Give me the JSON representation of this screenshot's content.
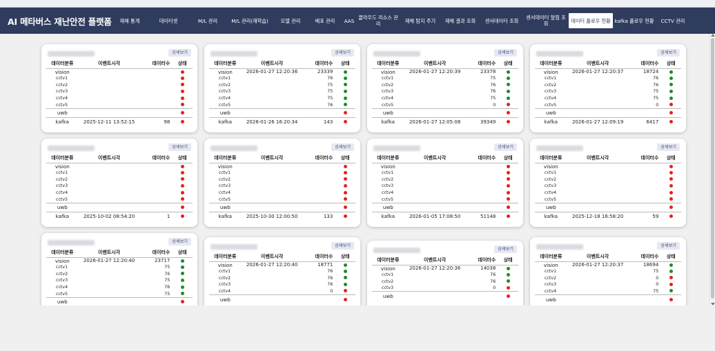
{
  "app": {
    "title": "AI 메타버스 재난안전 플랫폼",
    "menu": [
      {
        "label": "재해 통계",
        "w": 0
      },
      {
        "label": "데이터셋"
      },
      {
        "label": "M/L 관리"
      },
      {
        "label": "M/L 관리(재학습)"
      },
      {
        "label": "모델 관리"
      },
      {
        "label": "배포 관리"
      },
      {
        "label": "AAS"
      },
      {
        "label": "클라우드 리소스 관리"
      },
      {
        "label": "재해 탐지 주기"
      },
      {
        "label": "재해 결과 조회"
      },
      {
        "label": "센서데이터 조회"
      },
      {
        "label": "센서데이터 알림 조회"
      },
      {
        "label": "데이터 플로우 현황",
        "active": true
      },
      {
        "label": "kafka 플로우 현황"
      },
      {
        "label": "CCTV 관리"
      }
    ]
  },
  "labels": {
    "detail": "상세보기",
    "col_category": "데이터분류",
    "col_event_time": "이벤트시각",
    "col_count": "데이터수",
    "col_status": "상태"
  },
  "status_colors": {
    "red": "#e2231a",
    "green": "#1e8a2e"
  },
  "cards": [
    {
      "rows": [
        {
          "name": "vision",
          "time": "",
          "count": "",
          "status": "red"
        },
        {
          "name": "cctv1",
          "sub": true,
          "time": "",
          "count": "",
          "status": "red"
        },
        {
          "name": "cctv2",
          "sub": true,
          "time": "",
          "count": "",
          "status": "red"
        },
        {
          "name": "cctv3",
          "sub": true,
          "time": "",
          "count": "",
          "status": "red"
        },
        {
          "name": "cctv4",
          "sub": true,
          "time": "",
          "count": "",
          "status": "red"
        },
        {
          "name": "cctv5",
          "sub": true,
          "time": "",
          "count": "",
          "status": "red"
        },
        {
          "name": "uwb",
          "time": "",
          "count": "",
          "status": "red",
          "sep": true
        },
        {
          "name": "kafka",
          "time": "2025-12-11 13:52:15",
          "count": "98",
          "status": "red",
          "sep": true
        }
      ]
    },
    {
      "rows": [
        {
          "name": "vision",
          "time": "2026-01-27 12:20:36",
          "count": "23339",
          "status": "green"
        },
        {
          "name": "cctv1",
          "sub": true,
          "time": "",
          "count": "76",
          "status": "green"
        },
        {
          "name": "cctv2",
          "sub": true,
          "time": "",
          "count": "75",
          "status": "green"
        },
        {
          "name": "cctv3",
          "sub": true,
          "time": "",
          "count": "75",
          "status": "green"
        },
        {
          "name": "cctv4",
          "sub": true,
          "time": "",
          "count": "75",
          "status": "green"
        },
        {
          "name": "cctv5",
          "sub": true,
          "time": "",
          "count": "76",
          "status": "green"
        },
        {
          "name": "uwb",
          "time": "",
          "count": "",
          "status": "red",
          "sep": true
        },
        {
          "name": "kafka",
          "time": "2026-01-26 16:20:34",
          "count": "143",
          "status": "red",
          "sep": true
        }
      ]
    },
    {
      "rows": [
        {
          "name": "vision",
          "time": "2026-01-27 12:20:39",
          "count": "23378",
          "status": "green"
        },
        {
          "name": "cctv1",
          "sub": true,
          "time": "",
          "count": "75",
          "status": "green"
        },
        {
          "name": "cctv2",
          "sub": true,
          "time": "",
          "count": "76",
          "status": "green"
        },
        {
          "name": "cctv3",
          "sub": true,
          "time": "",
          "count": "76",
          "status": "green"
        },
        {
          "name": "cctv4",
          "sub": true,
          "time": "",
          "count": "75",
          "status": "green"
        },
        {
          "name": "cctv5",
          "sub": true,
          "time": "",
          "count": "0",
          "status": "red"
        },
        {
          "name": "uwb",
          "time": "",
          "count": "",
          "status": "red",
          "sep": true
        },
        {
          "name": "kafka",
          "time": "2026-01-27 12:05:08",
          "count": "39349",
          "status": "red",
          "sep": true
        }
      ]
    },
    {
      "rows": [
        {
          "name": "vision",
          "time": "2026-01-27 12:20:37",
          "count": "18724",
          "status": "green"
        },
        {
          "name": "cctv1",
          "sub": true,
          "time": "",
          "count": "76",
          "status": "green"
        },
        {
          "name": "cctv2",
          "sub": true,
          "time": "",
          "count": "76",
          "status": "green"
        },
        {
          "name": "cctv3",
          "sub": true,
          "time": "",
          "count": "75",
          "status": "green"
        },
        {
          "name": "cctv4",
          "sub": true,
          "time": "",
          "count": "75",
          "status": "green"
        },
        {
          "name": "cctv5",
          "sub": true,
          "time": "",
          "count": "0",
          "status": "red"
        },
        {
          "name": "uwb",
          "time": "",
          "count": "",
          "status": "red",
          "sep": true
        },
        {
          "name": "kafka",
          "time": "2026-01-27 12:09:19",
          "count": "6417",
          "status": "red",
          "sep": true
        }
      ]
    },
    {
      "rows": [
        {
          "name": "vision",
          "time": "",
          "count": "",
          "status": "red"
        },
        {
          "name": "cctv1",
          "sub": true,
          "time": "",
          "count": "",
          "status": "red"
        },
        {
          "name": "cctv2",
          "sub": true,
          "time": "",
          "count": "",
          "status": "red"
        },
        {
          "name": "cctv3",
          "sub": true,
          "time": "",
          "count": "",
          "status": "red"
        },
        {
          "name": "cctv4",
          "sub": true,
          "time": "",
          "count": "",
          "status": "red"
        },
        {
          "name": "cctv5",
          "sub": true,
          "time": "",
          "count": "",
          "status": "red"
        },
        {
          "name": "uwb",
          "time": "",
          "count": "",
          "status": "red",
          "sep": true
        },
        {
          "name": "kafka",
          "time": "2025-10-02 08:54:20",
          "count": "1",
          "status": "red",
          "sep": true
        }
      ]
    },
    {
      "rows": [
        {
          "name": "vision",
          "time": "",
          "count": "",
          "status": "red"
        },
        {
          "name": "cctv1",
          "sub": true,
          "time": "",
          "count": "",
          "status": "red"
        },
        {
          "name": "cctv2",
          "sub": true,
          "time": "",
          "count": "",
          "status": "red"
        },
        {
          "name": "cctv3",
          "sub": true,
          "time": "",
          "count": "",
          "status": "red"
        },
        {
          "name": "cctv4",
          "sub": true,
          "time": "",
          "count": "",
          "status": "red"
        },
        {
          "name": "cctv5",
          "sub": true,
          "time": "",
          "count": "",
          "status": "red"
        },
        {
          "name": "uwb",
          "time": "",
          "count": "",
          "status": "red",
          "sep": true
        },
        {
          "name": "kafka",
          "time": "2025-10-30 12:00:50",
          "count": "133",
          "status": "red",
          "sep": true
        }
      ]
    },
    {
      "rows": [
        {
          "name": "vision",
          "time": "",
          "count": "",
          "status": "red"
        },
        {
          "name": "cctv1",
          "sub": true,
          "time": "",
          "count": "",
          "status": "red"
        },
        {
          "name": "cctv2",
          "sub": true,
          "time": "",
          "count": "",
          "status": "red"
        },
        {
          "name": "cctv3",
          "sub": true,
          "time": "",
          "count": "",
          "status": "red"
        },
        {
          "name": "cctv4",
          "sub": true,
          "time": "",
          "count": "",
          "status": "red"
        },
        {
          "name": "cctv5",
          "sub": true,
          "time": "",
          "count": "",
          "status": "red"
        },
        {
          "name": "uwb",
          "time": "",
          "count": "",
          "status": "red",
          "sep": true
        },
        {
          "name": "kafka",
          "time": "2026-01-05 17:08:50",
          "count": "51148",
          "status": "red",
          "sep": true
        }
      ]
    },
    {
      "rows": [
        {
          "name": "vision",
          "time": "",
          "count": "",
          "status": "red"
        },
        {
          "name": "cctv1",
          "sub": true,
          "time": "",
          "count": "",
          "status": "red"
        },
        {
          "name": "cctv2",
          "sub": true,
          "time": "",
          "count": "",
          "status": "red"
        },
        {
          "name": "cctv3",
          "sub": true,
          "time": "",
          "count": "",
          "status": "red"
        },
        {
          "name": "cctv4",
          "sub": true,
          "time": "",
          "count": "",
          "status": "red"
        },
        {
          "name": "cctv5",
          "sub": true,
          "time": "",
          "count": "",
          "status": "red"
        },
        {
          "name": "uwb",
          "time": "",
          "count": "",
          "status": "red",
          "sep": true
        },
        {
          "name": "kafka",
          "time": "2025-12-18 16:58:20",
          "count": "59",
          "status": "red",
          "sep": true
        }
      ]
    },
    {
      "rows": [
        {
          "name": "vision",
          "time": "2026-01-27 12:20:40",
          "count": "23717",
          "status": "green"
        },
        {
          "name": "cctv1",
          "sub": true,
          "time": "",
          "count": "75",
          "status": "green"
        },
        {
          "name": "cctv2",
          "sub": true,
          "time": "",
          "count": "76",
          "status": "green"
        },
        {
          "name": "cctv3",
          "sub": true,
          "time": "",
          "count": "75",
          "status": "green"
        },
        {
          "name": "cctv4",
          "sub": true,
          "time": "",
          "count": "76",
          "status": "green"
        },
        {
          "name": "cctv5",
          "sub": true,
          "time": "",
          "count": "75",
          "status": "green"
        },
        {
          "name": "uwb",
          "time": "",
          "count": "",
          "status": "red",
          "sep": true
        }
      ]
    },
    {
      "rows": [
        {
          "name": "vision",
          "time": "2026-01-27 12:20:40",
          "count": "18771",
          "status": "green"
        },
        {
          "name": "cctv1",
          "sub": true,
          "time": "",
          "count": "76",
          "status": "green"
        },
        {
          "name": "cctv2",
          "sub": true,
          "time": "",
          "count": "76",
          "status": "green"
        },
        {
          "name": "cctv3",
          "sub": true,
          "time": "",
          "count": "76",
          "status": "green"
        },
        {
          "name": "cctv4",
          "sub": true,
          "time": "",
          "count": "0",
          "status": "red"
        },
        {
          "name": "uwb",
          "time": "",
          "count": "",
          "status": "red",
          "sep": true
        }
      ]
    },
    {
      "rows": [
        {
          "name": "vision",
          "time": "2026-01-27 12:20:36",
          "count": "14038",
          "status": "green"
        },
        {
          "name": "cctv1",
          "sub": true,
          "time": "",
          "count": "76",
          "status": "green"
        },
        {
          "name": "cctv2",
          "sub": true,
          "time": "",
          "count": "76",
          "status": "green"
        },
        {
          "name": "cctv3",
          "sub": true,
          "time": "",
          "count": "0",
          "status": "red"
        },
        {
          "name": "uwb",
          "time": "",
          "count": "",
          "status": "red",
          "sep": true
        }
      ]
    },
    {
      "rows": [
        {
          "name": "vision",
          "time": "2026-01-27 12:20:37",
          "count": "18694",
          "status": "green"
        },
        {
          "name": "cctv1",
          "sub": true,
          "time": "",
          "count": "75",
          "status": "green"
        },
        {
          "name": "cctv2",
          "sub": true,
          "time": "",
          "count": "0",
          "status": "red"
        },
        {
          "name": "cctv3",
          "sub": true,
          "time": "",
          "count": "0",
          "status": "red"
        },
        {
          "name": "cctv4",
          "sub": true,
          "time": "",
          "count": "75",
          "status": "green"
        },
        {
          "name": "uwb",
          "time": "",
          "count": "",
          "status": "red",
          "sep": true
        }
      ]
    }
  ]
}
